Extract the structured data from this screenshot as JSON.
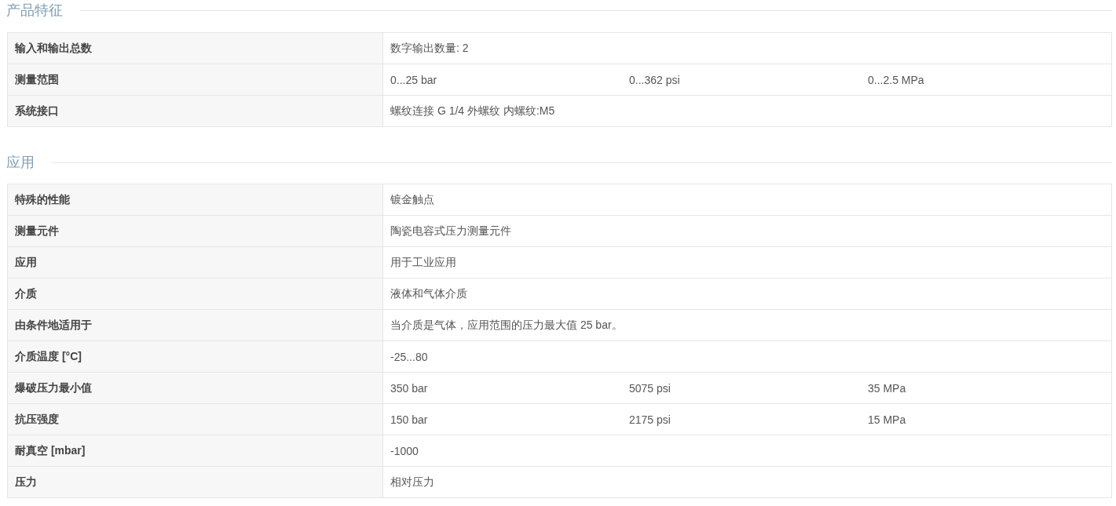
{
  "sections": [
    {
      "title": "产品特征",
      "rows": [
        {
          "label": "输入和输出总数",
          "values": [
            "数字输出数量: 2"
          ]
        },
        {
          "label": "测量范围",
          "values": [
            "0...25 bar",
            "0...362 psi",
            "0...2.5 MPa"
          ]
        },
        {
          "label": "系统接口",
          "values": [
            "螺纹连接 G 1/4 外螺纹 内螺纹:M5"
          ]
        }
      ]
    },
    {
      "title": "应用",
      "rows": [
        {
          "label": "特殊的性能",
          "values": [
            "镀金触点"
          ]
        },
        {
          "label": "测量元件",
          "values": [
            "陶瓷电容式压力测量元件"
          ]
        },
        {
          "label": "应用",
          "values": [
            "用于工业应用"
          ]
        },
        {
          "label": "介质",
          "values": [
            "液体和气体介质"
          ]
        },
        {
          "label": "由条件地适用于",
          "values": [
            "当介质是气体，应用范围的压力最大值 25 bar。"
          ]
        },
        {
          "label": "介质温度 [°C]",
          "values": [
            "-25...80"
          ]
        },
        {
          "label": "爆破压力最小值",
          "values": [
            "350 bar",
            "5075 psi",
            "35 MPa"
          ]
        },
        {
          "label": "抗压强度",
          "values": [
            "150 bar",
            "2175 psi",
            "15 MPa"
          ]
        },
        {
          "label": "耐真空 [mbar]",
          "values": [
            "-1000"
          ]
        },
        {
          "label": "压力",
          "values": [
            "相对压力"
          ]
        }
      ]
    }
  ]
}
